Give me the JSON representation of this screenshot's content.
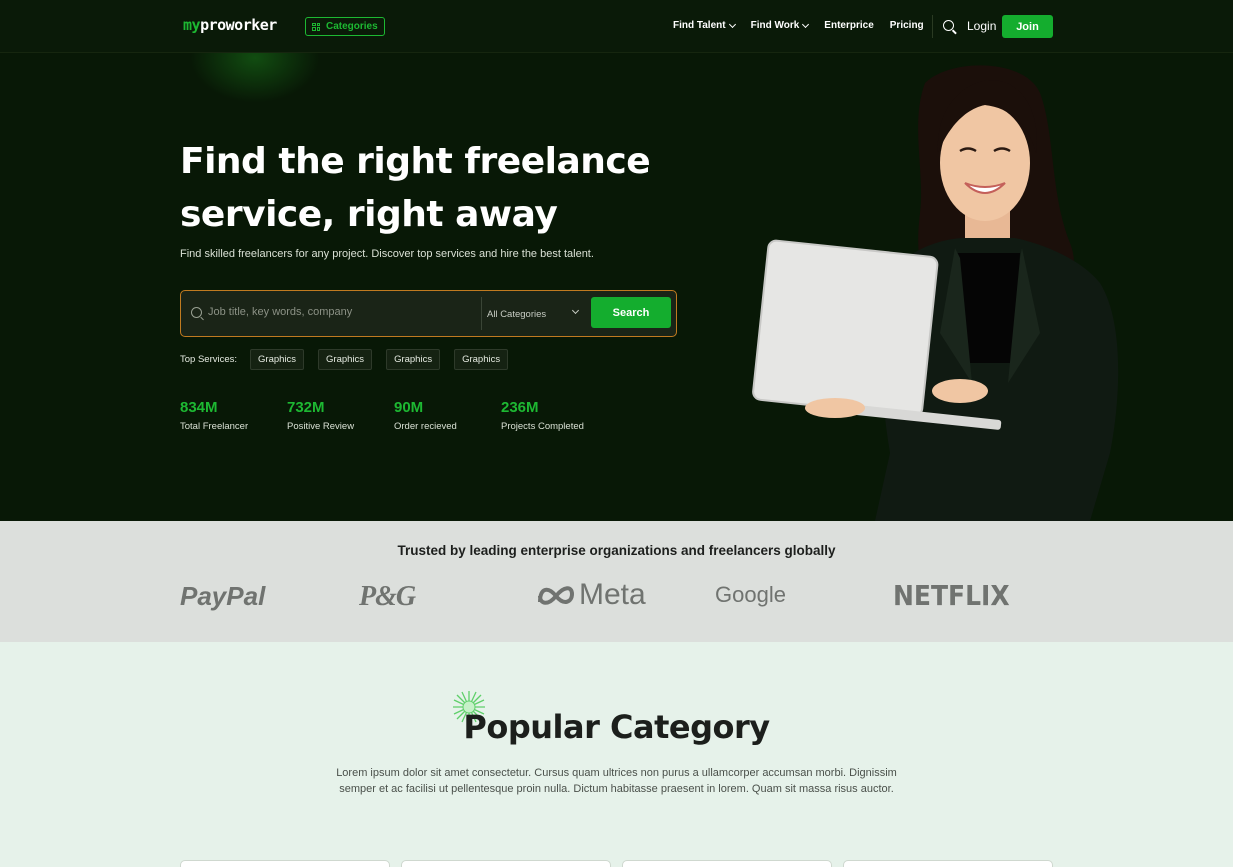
{
  "nav": {
    "logo_prefix": "my",
    "logo_rest": "proworker",
    "categories_label": "Categories",
    "links": [
      {
        "label": "Find Talent",
        "dropdown": true
      },
      {
        "label": "Find Work",
        "dropdown": true
      },
      {
        "label": "Enterprice",
        "dropdown": false
      },
      {
        "label": "Pricing",
        "dropdown": false
      }
    ],
    "search_icon": "search-icon",
    "login_label": "Login",
    "join_label": "Join"
  },
  "hero": {
    "title": "Find the right freelance service, right away",
    "subtitle": "Find skilled freelancers for any project. Discover top services and hire the best talent.",
    "search": {
      "placeholder": "Job title, key words, company",
      "category_selected": "All Categories",
      "button_label": "Search"
    },
    "top_services_label": "Top Services:",
    "top_services": [
      "Graphics",
      "Graphics",
      "Graphics",
      "Graphics"
    ],
    "stats": [
      {
        "value": "834M",
        "label": "Total Freelancer"
      },
      {
        "value": "732M",
        "label": "Positive Review"
      },
      {
        "value": "90M",
        "label": "Order recieved"
      },
      {
        "value": "236M",
        "label": "Projects Completed"
      }
    ]
  },
  "trusted": {
    "title": "Trusted by leading enterprise organizations and freelancers globally",
    "brands": [
      "PayPal",
      "P&G",
      "Meta",
      "Google",
      "NETFLIX"
    ]
  },
  "popular": {
    "title": "Popular Category",
    "description": "Lorem ipsum dolor sit amet consectetur. Cursus quam ultrices non purus a ullamcorper accumsan morbi. Dignissim semper et ac facilisi ut pellentesque proin nulla. Dictum habitasse praesent in lorem. Quam sit massa risus auctor."
  },
  "colors": {
    "accent": "#14ad2e",
    "hero_bg": "#081806",
    "trusted_bg": "#dcdfdc",
    "page_bg": "#e6f2ea"
  }
}
